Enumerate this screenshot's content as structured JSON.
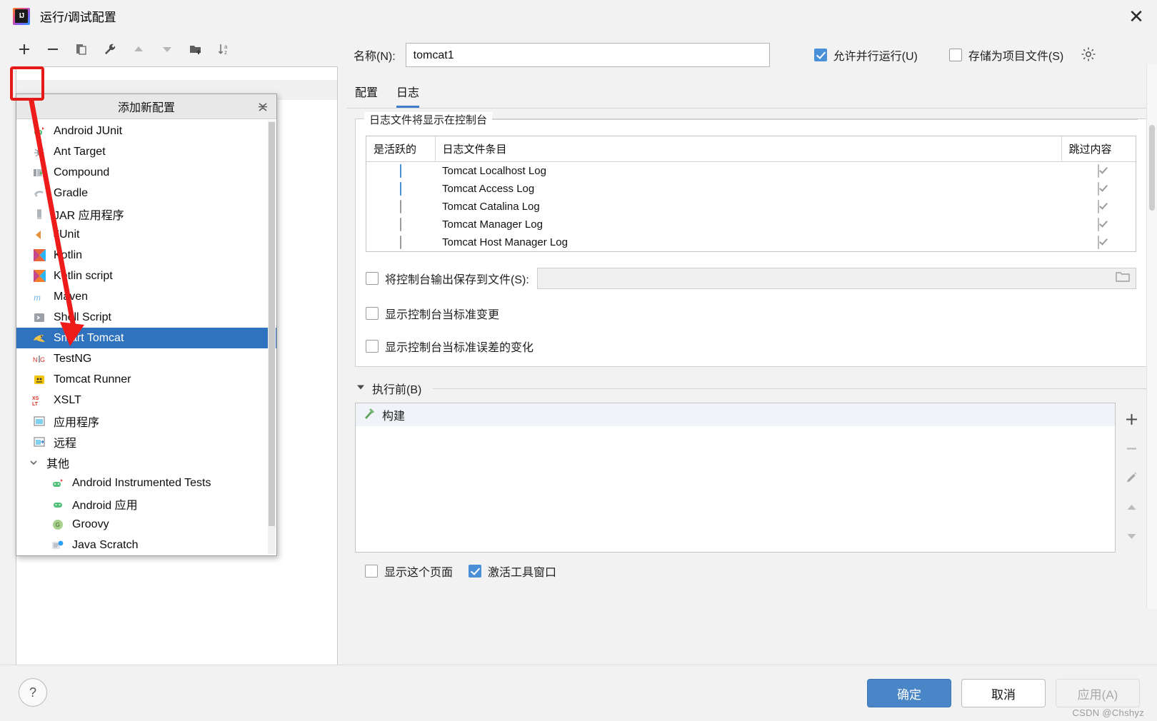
{
  "window": {
    "title": "运行/调试配置",
    "logo_icon": "intellij-idea-logo",
    "close_icon": "close-icon"
  },
  "left_toolbar": {
    "buttons": [
      {
        "name": "add-configuration-button",
        "icon": "plus-icon",
        "highlighted": true
      },
      {
        "name": "remove-configuration-button",
        "icon": "minus-icon"
      },
      {
        "name": "copy-configuration-button",
        "icon": "copy-icon"
      },
      {
        "name": "edit-templates-button",
        "icon": "wrench-icon"
      },
      {
        "name": "move-up-button",
        "icon": "arrow-up-icon"
      },
      {
        "name": "move-down-button",
        "icon": "arrow-down-icon"
      },
      {
        "name": "new-folder-button",
        "icon": "folder-add-icon"
      },
      {
        "name": "sort-button",
        "icon": "sort-alpha-icon"
      }
    ]
  },
  "popup": {
    "title": "添加新配置",
    "collapse_icon": "collapse-all-icon",
    "selected": "Smart Tomcat",
    "items": [
      {
        "label": "Android JUnit",
        "icon": "android-junit-icon"
      },
      {
        "label": "Ant Target",
        "icon": "ant-icon"
      },
      {
        "label": "Compound",
        "icon": "compound-icon"
      },
      {
        "label": "Gradle",
        "icon": "gradle-icon"
      },
      {
        "label": "JAR 应用程序",
        "icon": "jar-icon"
      },
      {
        "label": "JUnit",
        "icon": "junit-icon"
      },
      {
        "label": "Kotlin",
        "icon": "kotlin-icon"
      },
      {
        "label": "Kotlin script",
        "icon": "kotlin-script-icon"
      },
      {
        "label": "Maven",
        "icon": "maven-icon"
      },
      {
        "label": "Shell Script",
        "icon": "shell-script-icon"
      },
      {
        "label": "Smart Tomcat",
        "icon": "tomcat-icon",
        "selected": true
      },
      {
        "label": "TestNG",
        "icon": "testng-icon"
      },
      {
        "label": "Tomcat Runner",
        "icon": "tomcat-runner-icon"
      },
      {
        "label": "XSLT",
        "icon": "xslt-icon"
      },
      {
        "label": "应用程序",
        "icon": "application-icon"
      },
      {
        "label": "远程",
        "icon": "remote-icon"
      }
    ],
    "group": {
      "label": "其他",
      "expand_icon": "chevron-down-icon",
      "items": [
        {
          "label": "Android Instrumented Tests",
          "icon": "android-junit-icon"
        },
        {
          "label": "Android 应用",
          "icon": "android-icon"
        },
        {
          "label": "Groovy",
          "icon": "groovy-icon"
        },
        {
          "label": "Java Scratch",
          "icon": "java-scratch-icon"
        }
      ]
    }
  },
  "name_row": {
    "label": "名称(N):",
    "value": "tomcat1",
    "placeholder": "",
    "allow_parallel": {
      "label": "允许并行运行(U)",
      "checked": true
    },
    "store_as_project_file": {
      "label": "存储为项目文件(S)",
      "checked": false
    },
    "gear_icon": "gear-icon"
  },
  "tabs": [
    {
      "label": "配置",
      "active": false
    },
    {
      "label": "日志",
      "active": true
    }
  ],
  "logs_section": {
    "legend": "日志文件将显示在控制台",
    "columns": [
      "是活跃的",
      "日志文件条目",
      "跳过内容"
    ],
    "rows": [
      {
        "active": true,
        "entry": "Tomcat Localhost Log",
        "skip": true
      },
      {
        "active": true,
        "entry": "Tomcat Access Log",
        "skip": true
      },
      {
        "active": false,
        "entry": "Tomcat Catalina Log",
        "skip": true
      },
      {
        "active": false,
        "entry": "Tomcat Manager Log",
        "skip": true
      },
      {
        "active": false,
        "entry": "Tomcat Host Manager Log",
        "skip": true
      }
    ],
    "tools": [
      {
        "name": "add-log-button",
        "icon": "plus-icon"
      },
      {
        "name": "remove-log-button",
        "icon": "minus-icon"
      },
      {
        "name": "edit-log-button",
        "icon": "pencil-icon"
      }
    ],
    "options": [
      {
        "label": "将控制台输出保存到文件(S):",
        "checked": false,
        "has_field": true,
        "field_value": "",
        "browse_icon": "folder-icon"
      },
      {
        "label": "显示控制台当标准变更",
        "checked": false,
        "has_field": false
      },
      {
        "label": "显示控制台当标准误差的变化",
        "checked": false,
        "has_field": false
      }
    ]
  },
  "before_launch": {
    "title": "执行前(B)",
    "expand_icon": "triangle-down-icon",
    "items": [
      {
        "label": "构建",
        "icon": "build-hammer-icon"
      }
    ],
    "tools": [
      {
        "name": "add-task-button",
        "icon": "plus-icon"
      },
      {
        "name": "remove-task-button",
        "icon": "minus-icon"
      },
      {
        "name": "edit-task-button",
        "icon": "pencil-icon"
      },
      {
        "name": "move-task-up-button",
        "icon": "arrow-up-icon"
      },
      {
        "name": "move-task-down-button",
        "icon": "arrow-down-icon"
      }
    ]
  },
  "bottom_checks": [
    {
      "label": "显示这个页面",
      "checked": false
    },
    {
      "label": "激活工具窗口",
      "checked": true
    }
  ],
  "footer": {
    "help_icon": "question-mark-icon",
    "ok": "确定",
    "cancel": "取消",
    "apply": "应用(A)"
  },
  "watermark": "CSDN @Chshyz",
  "colors": {
    "accent": "#4a86c7",
    "selection": "#2f72bd",
    "checkbox_on": "#4a90d9",
    "highlight_box": "#e61919",
    "arrow": "#ee1b1b",
    "tab_underline": "#3d7dca"
  }
}
